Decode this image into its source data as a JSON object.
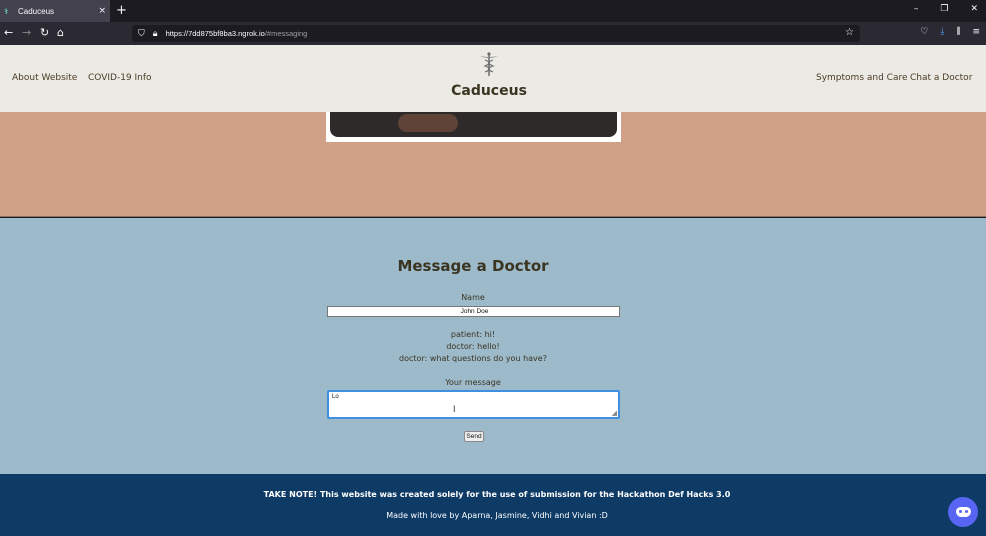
{
  "browser": {
    "tab_title": "Caduceus",
    "tab_close": "×",
    "new_tab": "+",
    "url_host": "https://7dd875bf8ba3.ngrok.io",
    "url_path": "/#messaging",
    "win_minimize": "–",
    "win_restore": "❐",
    "win_close": "✕",
    "back": "←",
    "forward": "→",
    "reload": "↻",
    "home": "⌂",
    "bookmark": "☆",
    "menu": "≡"
  },
  "header": {
    "nav_left": [
      "About Website",
      "COVID-19 Info"
    ],
    "brand": "Caduceus",
    "nav_right": [
      "Symptoms and Care",
      "Chat a Doctor"
    ]
  },
  "messaging": {
    "title": "Message a Doctor",
    "name_label": "Name",
    "name_value": "John Doe",
    "chat": [
      "patient: hi!",
      "doctor: hello!",
      "doctor: what questions do you have?"
    ],
    "message_label": "Your message",
    "message_value": "Lo",
    "send_label": "Send"
  },
  "footer": {
    "note": "TAKE NOTE! This website was created solely for the use of submission for the Hackathon Def Hacks 3.0",
    "credits": "Made with love by Aparna, Jasmine, Vidhi and Vivian :D"
  },
  "colors": {
    "header_bg": "#eceae5",
    "hero_bg": "#d0a187",
    "message_bg": "#9dbacb",
    "footer_bg": "#0e3a66",
    "discord": "#5865f2"
  }
}
